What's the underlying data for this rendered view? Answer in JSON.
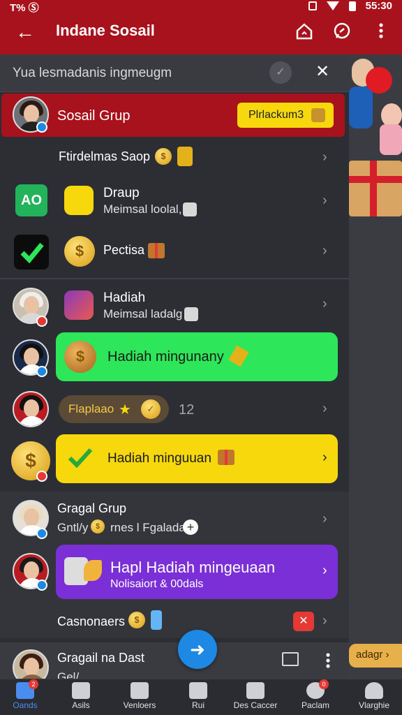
{
  "status_bar": {
    "left": "T% Ⓢ",
    "time": "55:30"
  },
  "header": {
    "title": "Indane Sosail",
    "back_icon": "←"
  },
  "search": {
    "placeholder": "Yua lesmadanis ingmeugm"
  },
  "rows": {
    "sosial_grup": {
      "name": "Sosail Grup",
      "pill": "Plrlackum3"
    },
    "ftirdelmas": {
      "name": "Ftirdelmas Saop"
    },
    "draup": {
      "name": "Draup",
      "sub": "Meimsal loolal,",
      "tile": "AO"
    },
    "pectisa": {
      "name": "Pectisa"
    },
    "hadiah": {
      "name": "Hadiah",
      "sub": "Meimsal ladalg"
    },
    "green_banner": {
      "label": "Hadiah mingunany"
    },
    "flaplaao": {
      "label": "Flaplaao",
      "count": "12"
    },
    "yellow_banner": {
      "label": "Hadiah minguuan"
    },
    "gragal_grup": {
      "name": "Gragal Grup",
      "sub": "Gntl/y",
      "sub2": "rnes l Fgaladal"
    },
    "purple_banner": {
      "title": "Hapl Hadiah mingeuaan",
      "sub": "Nolisaiort & 00dals"
    },
    "casnonaers": {
      "name": "Casnonaers"
    },
    "gragail_dast": {
      "name": "Gragail na Dast",
      "sub": "Gel/"
    }
  },
  "side_pill": "adagr",
  "nav": [
    {
      "label": "Oands",
      "badge": "2",
      "active": true
    },
    {
      "label": "Asils",
      "badge": "",
      "active": false
    },
    {
      "label": "Venloers",
      "badge": "",
      "active": false
    },
    {
      "label": "Rui",
      "badge": "",
      "active": false
    },
    {
      "label": "Des Caccer",
      "badge": "",
      "active": false
    },
    {
      "label": "Paclam",
      "badge": "0",
      "active": false
    },
    {
      "label": "Vlarghie",
      "badge": "",
      "active": false
    }
  ],
  "colors": {
    "header_red": "#a8121c",
    "accent_yellow": "#f6d80d",
    "accent_green": "#2ee65a",
    "accent_purple": "#7b2fd6",
    "nav_active": "#4a8df0"
  }
}
